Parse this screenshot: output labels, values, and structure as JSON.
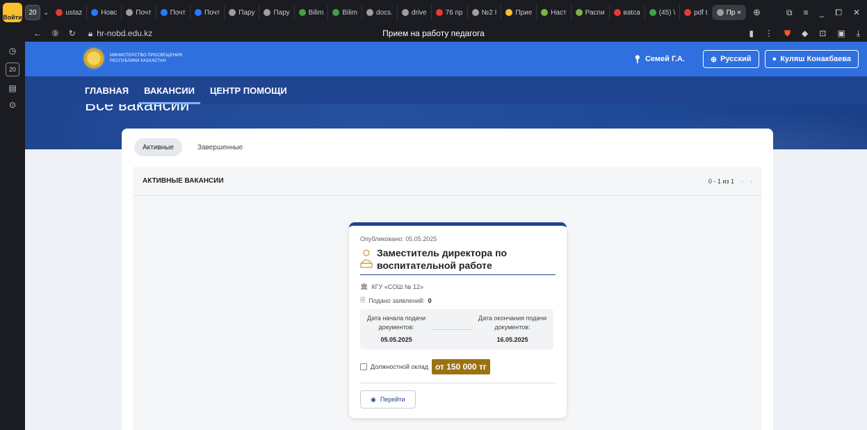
{
  "browser": {
    "login_badge": "Войти",
    "tab_count": "20",
    "tabs": [
      {
        "label": "ustaz",
        "color": "#e53935"
      },
      {
        "label": "Новс",
        "color": "#2979ff"
      },
      {
        "label": "Почт",
        "color": "#9e9e9e"
      },
      {
        "label": "Почт",
        "color": "#2979ff"
      },
      {
        "label": "Почт",
        "color": "#2979ff"
      },
      {
        "label": "Пару",
        "color": "#9e9e9e"
      },
      {
        "label": "Пару",
        "color": "#9e9e9e"
      },
      {
        "label": "Bilim",
        "color": "#43a047"
      },
      {
        "label": "Bilim",
        "color": "#43a047"
      },
      {
        "label": "docs.",
        "color": "#9e9e9e"
      },
      {
        "label": "drive",
        "color": "#9e9e9e"
      },
      {
        "label": "76 пр",
        "color": "#e53935"
      },
      {
        "label": "№2 І",
        "color": "#9e9e9e"
      },
      {
        "label": "Прие",
        "color": "#fbc02d"
      },
      {
        "label": "Наст",
        "color": "#7cb342"
      },
      {
        "label": "Распи",
        "color": "#7cb342"
      },
      {
        "label": "вatca",
        "color": "#e53935"
      },
      {
        "label": "(45) \\",
        "color": "#43a047"
      },
      {
        "label": "pdf t",
        "color": "#e53935"
      },
      {
        "label": "Пр ×",
        "color": "#9e9e9e"
      }
    ],
    "url": "hr-nobd.edu.kz",
    "page_title": "Прием на работу педагога",
    "sidebar_badge": "20"
  },
  "site": {
    "ministry_line1": "МИНИСТЕРСТВО ПРОСВЕЩЕНИЯ",
    "ministry_line2": "РЕСПУБЛИКИ КАЗАХСТАН",
    "location": "Семей Г.А.",
    "language": "Русский",
    "user": "Куляш Конакбаева",
    "nav": [
      "ГЛАВНАЯ",
      "ВАКАНСИИ",
      "ЦЕНТР ПОМОЩИ"
    ],
    "banner_title": "Все вакансии"
  },
  "filters": {
    "active": "Активные",
    "completed": "Завершенные"
  },
  "list": {
    "title": "АКТИВНЫЕ ВАКАНСИИ",
    "pager": "0 - 1 из 1"
  },
  "vacancy": {
    "published": "Опубликовано: 05.05.2025",
    "title_line1": "Заместитель директора по",
    "title_line2": "воспитательной работе",
    "org": "КГУ «СОШ № 12»",
    "apps_label": "Подано заявлений:",
    "apps_count": "0",
    "start_label_1": "Дата начала подачи",
    "start_label_2": "документов:",
    "start_date": "05.05.2025",
    "end_label_1": "Дата окончания подачи",
    "end_label_2": "документов:",
    "end_date": "16.05.2025",
    "salary_label": "Должностной оклад",
    "salary_value": "от 150 000 тг",
    "go_label": "Перейти"
  }
}
